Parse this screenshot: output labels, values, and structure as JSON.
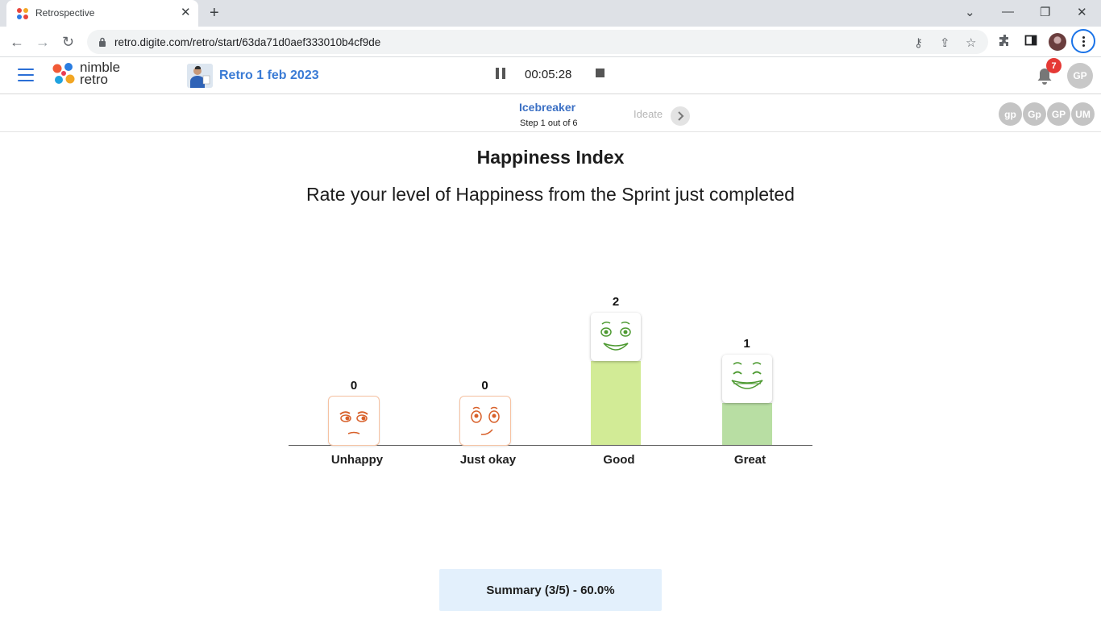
{
  "browser": {
    "tab_title": "Retrospective",
    "url": "retro.digite.com/retro/start/63da71d0aef333010b4cf9de"
  },
  "header": {
    "logo_line1": "nimble",
    "logo_line2": "retro",
    "retro_name": "Retro 1 feb 2023",
    "timer": "00:05:28",
    "notification_count": "7",
    "user_initials": "GP"
  },
  "stepbar": {
    "current_step": "Icebreaker",
    "step_progress": "Step 1 out of 6",
    "next_step": "Ideate",
    "participants": [
      "gp",
      "Gp",
      "GP",
      "UM"
    ]
  },
  "main": {
    "title": "Happiness Index",
    "subtitle": "Rate your level of Happiness from the Sprint just completed",
    "summary": "Summary (3/5) - 60.0%"
  },
  "chart_data": {
    "type": "bar",
    "categories": [
      "Unhappy",
      "Just okay",
      "Good",
      "Great"
    ],
    "values": [
      0,
      0,
      2,
      1
    ],
    "title": "Happiness Index",
    "xlabel": "",
    "ylabel": "",
    "colors": [
      "#f6c2a2",
      "#f6c2a2",
      "#d2eb96",
      "#b8dea3"
    ],
    "face_colors": [
      "#d8602a",
      "#d8602a",
      "#4e9a32",
      "#4e9a32"
    ]
  }
}
